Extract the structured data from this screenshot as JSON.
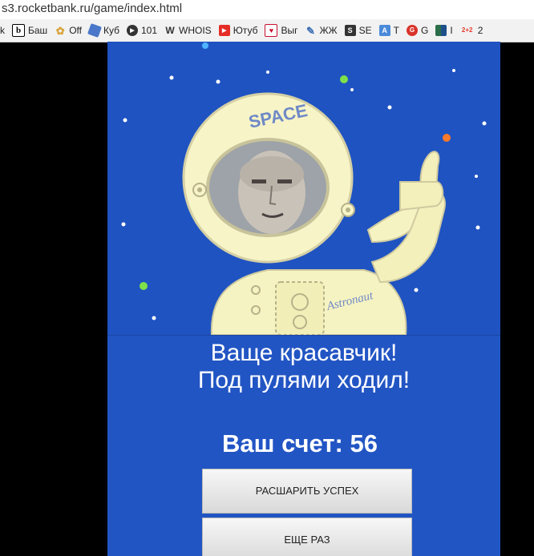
{
  "browser": {
    "url": "s3.rocketbank.ru/game/index.html",
    "bookmarks": [
      {
        "label": "k",
        "icon": "none",
        "color": ""
      },
      {
        "label": "Баш",
        "icon": "b-icon",
        "color": "#ffffff"
      },
      {
        "label": "Off",
        "icon": "star-icon",
        "color": "#d9a43a"
      },
      {
        "label": "Куб",
        "icon": "cube-icon",
        "color": "#4a77c9"
      },
      {
        "label": "101",
        "icon": "play-icon",
        "color": "#333333"
      },
      {
        "label": "WHOIS",
        "icon": "whois-icon",
        "color": "#333333"
      },
      {
        "label": "Ютуб",
        "icon": "youtube-icon",
        "color": "#e52d27"
      },
      {
        "label": "Выг",
        "icon": "flag-icon",
        "color": "#c8102e"
      },
      {
        "label": "ЖЖ",
        "icon": "pencil-icon",
        "color": "#3b6fb5"
      },
      {
        "label": "SE",
        "icon": "se-icon",
        "color": "#333333"
      },
      {
        "label": "T",
        "icon": "translate-icon",
        "color": "#4a8ad9"
      },
      {
        "label": "G",
        "icon": "g-icon",
        "color": "#d9332a"
      },
      {
        "label": "I",
        "icon": "i-icon",
        "color": "#2c6e49"
      },
      {
        "label": "2",
        "icon": "2plus2-icon",
        "color": "#e63b2e"
      }
    ]
  },
  "game": {
    "helmet_text": "SPACE",
    "suit_text": "Astronaut",
    "result_line1": "Ваще красавчик!",
    "result_line2": "Под пулями ходил!",
    "score_text": "Ваш счет: 56",
    "share_button": "РАСШАРИТЬ УСПЕХ",
    "again_button": "ЕЩЕ РАЗ"
  }
}
